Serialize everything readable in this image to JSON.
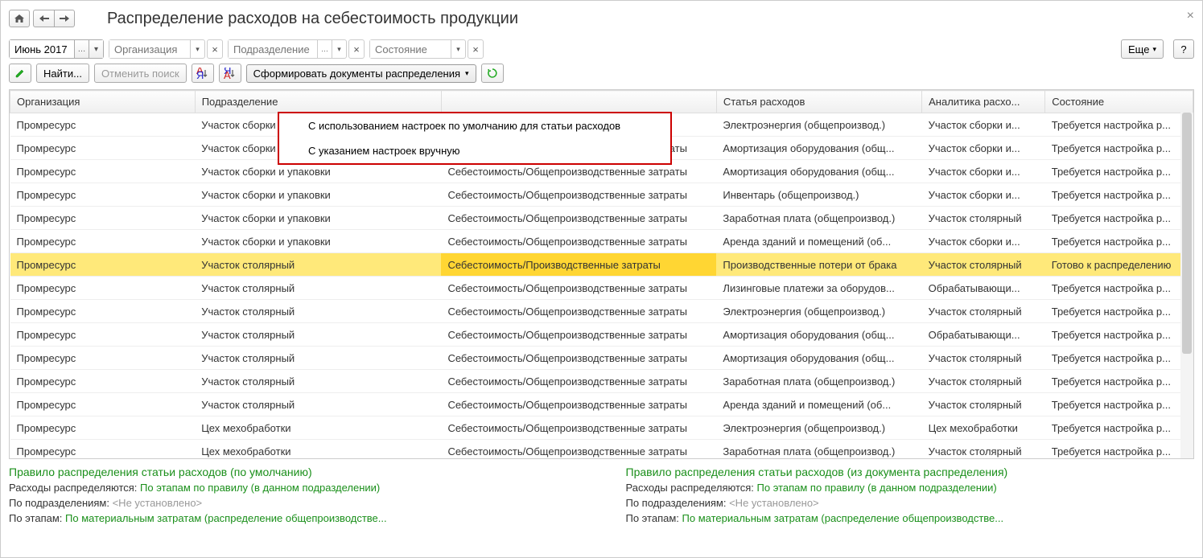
{
  "title": "Распределение расходов на себестоимость продукции",
  "nav": {
    "home_icon": "home",
    "back_icon": "arrow-left",
    "fwd_icon": "arrow-right"
  },
  "filters": {
    "period": "Июнь 2017",
    "org_placeholder": "Организация",
    "dep_placeholder": "Подразделение",
    "state_placeholder": "Состояние",
    "more_label": "Еще",
    "help_label": "?"
  },
  "toolbar": {
    "find_label": "Найти...",
    "cancel_search_label": "Отменить поиск",
    "generate_label": "Сформировать документы распределения"
  },
  "dropdown": {
    "item1": "С использованием настроек по умолчанию для статьи расходов",
    "item2": "С указанием настроек вручную"
  },
  "columns": {
    "org": "Организация",
    "dep": "Подразделение",
    "group": "",
    "article": "Статья расходов",
    "analytics": "Аналитика расхо...",
    "state": "Состояние"
  },
  "rows": [
    {
      "org": "Промресурс",
      "dep": "Участок сборки",
      "group": "",
      "article": "Электроэнергия (общепроизвод.)",
      "analytics": "Участок сборки и...",
      "state": "Требуется настройка р..."
    },
    {
      "org": "Промресурс",
      "dep": "Участок сборки и упаковки",
      "group": "Себестоимость/Общепроизводственные затраты",
      "article": "Амортизация оборудования (общ...",
      "analytics": "Участок сборки и...",
      "state": "Требуется настройка р..."
    },
    {
      "org": "Промресурс",
      "dep": "Участок сборки и упаковки",
      "group": "Себестоимость/Общепроизводственные затраты",
      "article": "Амортизация оборудования (общ...",
      "analytics": "Участок сборки и...",
      "state": "Требуется настройка р..."
    },
    {
      "org": "Промресурс",
      "dep": "Участок сборки и упаковки",
      "group": "Себестоимость/Общепроизводственные затраты",
      "article": "Инвентарь (общепроизвод.)",
      "analytics": "Участок сборки и...",
      "state": "Требуется настройка р..."
    },
    {
      "org": "Промресурс",
      "dep": "Участок сборки и упаковки",
      "group": "Себестоимость/Общепроизводственные затраты",
      "article": "Заработная плата (общепроизвод.)",
      "analytics": "Участок столярный",
      "state": "Требуется настройка р..."
    },
    {
      "org": "Промресурс",
      "dep": "Участок сборки и упаковки",
      "group": "Себестоимость/Общепроизводственные затраты",
      "article": "Аренда зданий и помещений (об...",
      "analytics": "Участок сборки и...",
      "state": "Требуется настройка р..."
    },
    {
      "org": "Промресурс",
      "dep": "Участок столярный",
      "group": "Себестоимость/Производственные затраты",
      "article": "Производственные потери от брака",
      "analytics": "Участок столярный",
      "state": "Готово к распределению",
      "selected": true
    },
    {
      "org": "Промресурс",
      "dep": "Участок столярный",
      "group": "Себестоимость/Общепроизводственные затраты",
      "article": "Лизинговые платежи за оборудов...",
      "analytics": "Обрабатывающи...",
      "state": "Требуется настройка р..."
    },
    {
      "org": "Промресурс",
      "dep": "Участок столярный",
      "group": "Себестоимость/Общепроизводственные затраты",
      "article": "Электроэнергия (общепроизвод.)",
      "analytics": "Участок столярный",
      "state": "Требуется настройка р..."
    },
    {
      "org": "Промресурс",
      "dep": "Участок столярный",
      "group": "Себестоимость/Общепроизводственные затраты",
      "article": "Амортизация оборудования (общ...",
      "analytics": "Обрабатывающи...",
      "state": "Требуется настройка р..."
    },
    {
      "org": "Промресурс",
      "dep": "Участок столярный",
      "group": "Себестоимость/Общепроизводственные затраты",
      "article": "Амортизация оборудования (общ...",
      "analytics": "Участок столярный",
      "state": "Требуется настройка р..."
    },
    {
      "org": "Промресурс",
      "dep": "Участок столярный",
      "group": "Себестоимость/Общепроизводственные затраты",
      "article": "Заработная плата (общепроизвод.)",
      "analytics": "Участок столярный",
      "state": "Требуется настройка р..."
    },
    {
      "org": "Промресурс",
      "dep": "Участок столярный",
      "group": "Себестоимость/Общепроизводственные затраты",
      "article": "Аренда зданий и помещений (об...",
      "analytics": "Участок столярный",
      "state": "Требуется настройка р..."
    },
    {
      "org": "Промресурс",
      "dep": "Цех мехобработки",
      "group": "Себестоимость/Общепроизводственные затраты",
      "article": "Электроэнергия (общепроизвод.)",
      "analytics": "Цех мехобработки",
      "state": "Требуется настройка р..."
    },
    {
      "org": "Промресурс",
      "dep": "Цех мехобработки",
      "group": "Себестоимость/Общепроизводственные затраты",
      "article": "Заработная плата (общепроизвод.)",
      "analytics": "Участок столярный",
      "state": "Требуется настройка р..."
    }
  ],
  "footer": {
    "left_title": "Правило распределения статьи расходов (по умолчанию)",
    "right_title": "Правило распределения статьи расходов (из документа распределения)",
    "line1_label": "Расходы распределяются: ",
    "line1_link": "По этапам по правилу (в данном подразделении)",
    "line2_label": "По подразделениям: ",
    "line2_value": "<Не установлено>",
    "line3_label": "По этапам: ",
    "line3_link": "По материальным затратам (распределение общепроизводстве..."
  }
}
